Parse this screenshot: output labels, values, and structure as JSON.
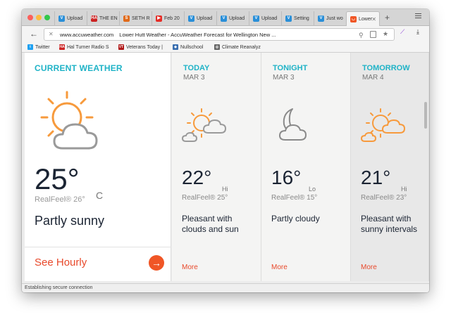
{
  "tabs": [
    {
      "label": "Upload",
      "fav": "V",
      "fav_color": "#2a8fd8"
    },
    {
      "label": "THE EN",
      "fav": "HA",
      "fav_color": "#cc2222"
    },
    {
      "label": "SETH R",
      "fav": "S",
      "fav_color": "#e06a1a"
    },
    {
      "label": "Feb 20",
      "fav": "▶",
      "fav_color": "#e52d27"
    },
    {
      "label": "Upload",
      "fav": "V",
      "fav_color": "#2a8fd8"
    },
    {
      "label": "Upload",
      "fav": "V",
      "fav_color": "#2a8fd8"
    },
    {
      "label": "Upload",
      "fav": "V",
      "fav_color": "#2a8fd8"
    },
    {
      "label": "Setting",
      "fav": "V",
      "fav_color": "#2a8fd8"
    },
    {
      "label": "Just wo",
      "fav": "V",
      "fav_color": "#2a8fd8"
    },
    {
      "label": "Lower",
      "fav": "◡",
      "fav_color": "#f05626",
      "active": true
    }
  ],
  "url": {
    "host": "www.accuweather.com",
    "title": "Lower Hutt Weather - AccuWeather Forecast for Wellington New ..."
  },
  "bookmarks": [
    {
      "label": "Twitter",
      "fav": "t",
      "color": "#1da1f2"
    },
    {
      "label": "Hal Turner Radio S",
      "fav": "HA",
      "color": "#cc2222"
    },
    {
      "label": "Veterans Today |",
      "fav": "VT",
      "color": "#b01818"
    },
    {
      "label": "Nullschool",
      "fav": "◆",
      "color": "#3a6fb0"
    },
    {
      "label": "Climate Reanalyz",
      "fav": "◎",
      "color": "#666666"
    }
  ],
  "current": {
    "title": "CURRENT WEATHER",
    "temp": "25°",
    "unit": "C",
    "realfeel": "RealFeel® 26°",
    "phrase": "Partly sunny",
    "see_hourly": "See Hourly",
    "arrow": "→"
  },
  "forecast": [
    {
      "title": "TODAY",
      "date": "MAR 3",
      "temp": "22°",
      "unit": "Hi",
      "realfeel": "RealFeel® 25°",
      "phrase": "Pleasant with clouds and sun",
      "more": "More",
      "icon": "partly-sunny-icon"
    },
    {
      "title": "TONIGHT",
      "date": "MAR 3",
      "temp": "16°",
      "unit": "Lo",
      "realfeel": "RealFeel® 15°",
      "phrase": "Partly cloudy",
      "more": "More",
      "icon": "partly-cloudy-night-icon"
    },
    {
      "title": "TOMORROW",
      "date": "MAR 4",
      "temp": "21°",
      "unit": "Hi",
      "realfeel": "RealFeel® 23°",
      "phrase": "Pleasant with sunny intervals",
      "more": "More",
      "icon": "partly-sunny-icon"
    }
  ],
  "status": "Establishing secure connection",
  "colors": {
    "accent": "#1fb3c7",
    "link": "#e8492b",
    "sun": "#f79a3c"
  }
}
